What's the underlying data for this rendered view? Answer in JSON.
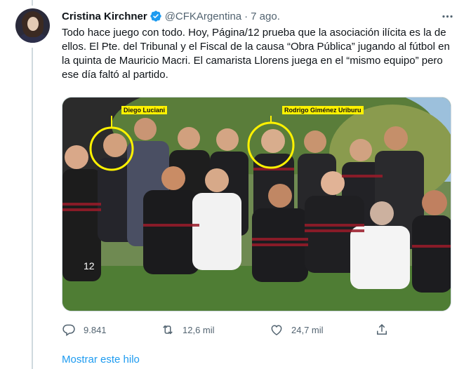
{
  "tweet": {
    "author_name": "Cristina Kirchner",
    "handle": "@CFKArgentina",
    "separator": "·",
    "time": "7 ago.",
    "text": "Todo hace juego con todo. Hoy, Página/12 prueba que la asociación ilícita es la de ellos. El Pte. del Tribunal y el Fiscal de la causa “Obra Pública” jugando al fútbol en la quinta de Mauricio Macri. El camarista Llorens juega en el “mismo equipo” pero ese día faltó al partido.",
    "media_labels": [
      "Diego Luciani",
      "Rodrigo Giménez Uriburu"
    ],
    "jersey_number": "12"
  },
  "actions": {
    "replies": "9.841",
    "retweets": "12,6 mil",
    "likes": "24,7 mil"
  },
  "show_thread_label": "Mostrar este hilo",
  "colors": {
    "accent": "#1d9bf0",
    "secondary_text": "#536471",
    "label_highlight": "#fff200"
  },
  "icons": [
    "verified-badge-icon",
    "more-icon",
    "reply-icon",
    "retweet-icon",
    "like-icon",
    "share-icon"
  ]
}
